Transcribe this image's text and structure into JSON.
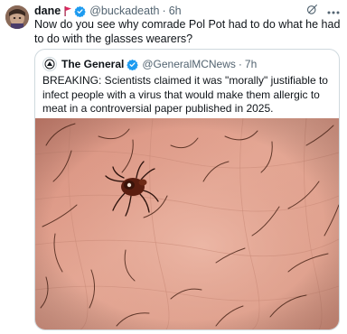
{
  "post": {
    "author_name": "dane",
    "handle": "@buckadeath",
    "separator": "·",
    "time": "6h",
    "text": "Now do you see why comrade Pol Pot had to do what he had to do with the glasses wearers?",
    "icons": [
      "avatar-photo",
      "red-flag-icon",
      "verified-badge-icon",
      "grok-icon",
      "more-icon"
    ]
  },
  "quote": {
    "author_name": "The General",
    "handle": "@GeneralMCNews",
    "separator": "·",
    "time": "7h",
    "text": "BREAKING: Scientists claimed it was \"morally\" justifiable to infect people with a virus that would make them allergic to meat in a controversial paper published in 2025.",
    "media": "photo-of-tick-on-hairy-skin",
    "icons": [
      "news-logo-icon",
      "verified-badge-icon"
    ]
  },
  "colors": {
    "text": "#0f1419",
    "secondary": "#536471",
    "verified": "#1d9bf0",
    "border": "#cfd9de",
    "flag": "#e0245e"
  }
}
